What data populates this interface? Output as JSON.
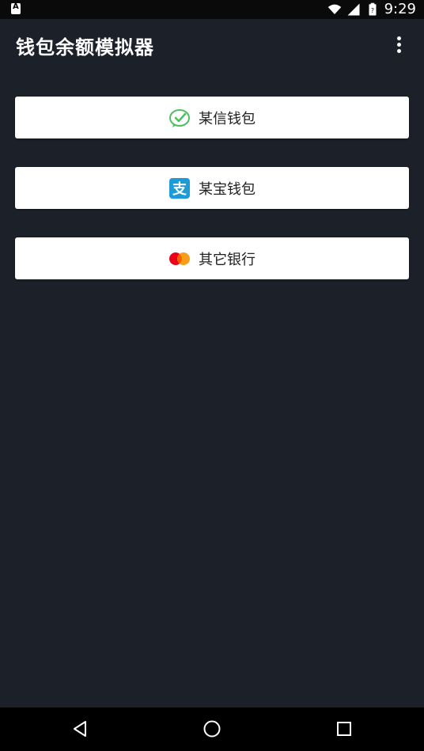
{
  "status_bar": {
    "time": "9:29",
    "icons": [
      "wifi-icon",
      "signal-icon",
      "battery-icon"
    ]
  },
  "app_bar": {
    "title": "钱包余额模拟器",
    "overflow_icon": "more-vert-icon"
  },
  "options": [
    {
      "label": "某信钱包",
      "icon": "wechat-icon",
      "icon_color": "#4cbf5e"
    },
    {
      "label": "某宝钱包",
      "icon": "alipay-icon",
      "icon_color": "#1d9bd7"
    },
    {
      "label": "其它银行",
      "icon": "mastercard-icon",
      "icon_color": "#eb001b"
    }
  ],
  "nav_bar": {
    "icons": [
      "back-icon",
      "home-icon",
      "recents-icon"
    ]
  },
  "colors": {
    "background": "#1b2029",
    "card": "#ffffff",
    "status_bar": "#0a0a0a",
    "nav_bar": "#000000"
  }
}
